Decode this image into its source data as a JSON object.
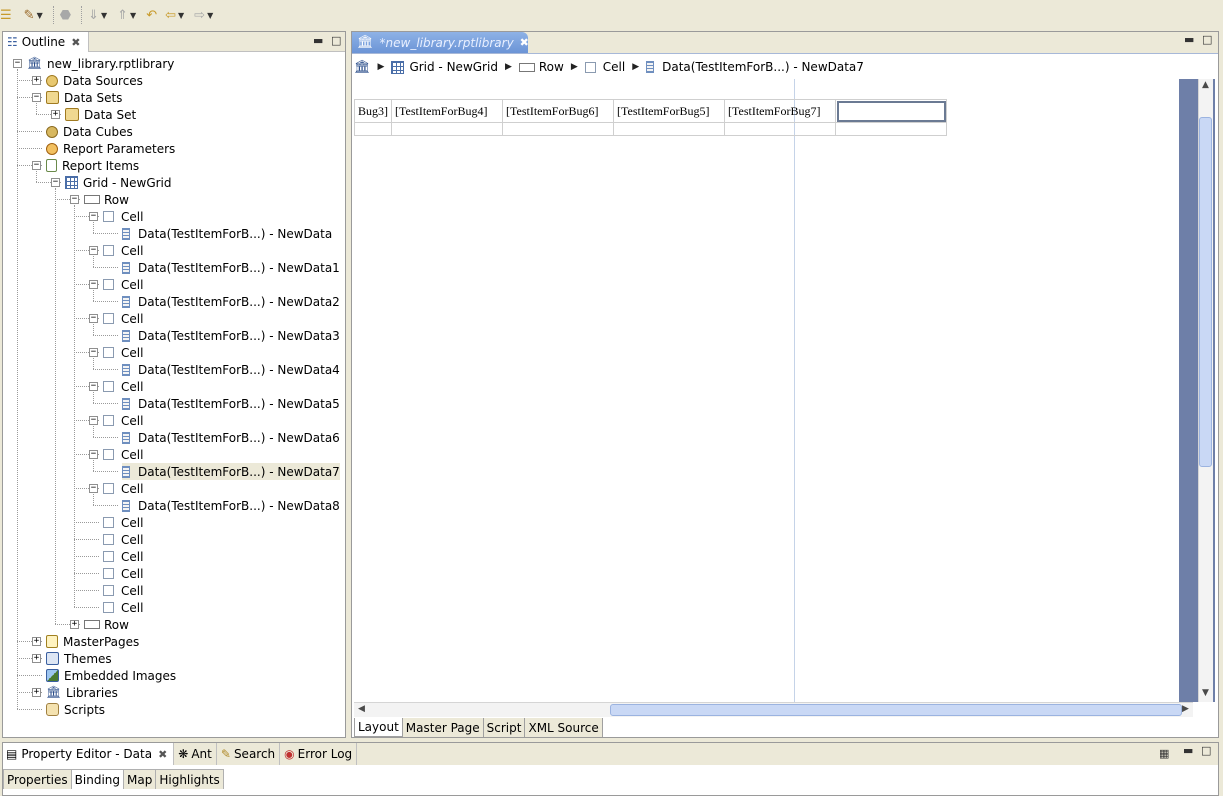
{
  "outline": {
    "title": "Outline",
    "tree": [
      {
        "label": "new_library.rptlibrary",
        "icon": "library-icon",
        "depth": 0,
        "expander": "minus"
      },
      {
        "label": "Data Sources",
        "icon": "data-sources-icon",
        "depth": 1,
        "expander": "plus"
      },
      {
        "label": "Data Sets",
        "icon": "data-sets-icon",
        "depth": 1,
        "expander": "minus"
      },
      {
        "label": "Data Set",
        "icon": "data-set-icon",
        "depth": 2,
        "expander": "plus"
      },
      {
        "label": "Data Cubes",
        "icon": "data-cubes-icon",
        "depth": 1,
        "expander": ""
      },
      {
        "label": "Report Parameters",
        "icon": "report-parameters-icon",
        "depth": 1,
        "expander": ""
      },
      {
        "label": "Report Items",
        "icon": "report-items-icon",
        "depth": 1,
        "expander": "minus"
      },
      {
        "label": "Grid - NewGrid",
        "icon": "grid-icon",
        "depth": 2,
        "expander": "minus"
      },
      {
        "label": "Row",
        "icon": "row-icon",
        "depth": 3,
        "expander": "minus"
      },
      {
        "label": "Cell",
        "icon": "cell-icon",
        "depth": 4,
        "expander": "minus"
      },
      {
        "label": "Data(TestItemForB...) - NewData",
        "icon": "data-item-icon",
        "depth": 5,
        "expander": ""
      },
      {
        "label": "Cell",
        "icon": "cell-icon",
        "depth": 4,
        "expander": "minus"
      },
      {
        "label": "Data(TestItemForB...) - NewData1",
        "icon": "data-item-icon",
        "depth": 5,
        "expander": ""
      },
      {
        "label": "Cell",
        "icon": "cell-icon",
        "depth": 4,
        "expander": "minus"
      },
      {
        "label": "Data(TestItemForB...) - NewData2",
        "icon": "data-item-icon",
        "depth": 5,
        "expander": ""
      },
      {
        "label": "Cell",
        "icon": "cell-icon",
        "depth": 4,
        "expander": "minus"
      },
      {
        "label": "Data(TestItemForB...) - NewData3",
        "icon": "data-item-icon",
        "depth": 5,
        "expander": ""
      },
      {
        "label": "Cell",
        "icon": "cell-icon",
        "depth": 4,
        "expander": "minus"
      },
      {
        "label": "Data(TestItemForB...) - NewData4",
        "icon": "data-item-icon",
        "depth": 5,
        "expander": ""
      },
      {
        "label": "Cell",
        "icon": "cell-icon",
        "depth": 4,
        "expander": "minus"
      },
      {
        "label": "Data(TestItemForB...) - NewData5",
        "icon": "data-item-icon",
        "depth": 5,
        "expander": ""
      },
      {
        "label": "Cell",
        "icon": "cell-icon",
        "depth": 4,
        "expander": "minus"
      },
      {
        "label": "Data(TestItemForB...) - NewData6",
        "icon": "data-item-icon",
        "depth": 5,
        "expander": ""
      },
      {
        "label": "Cell",
        "icon": "cell-icon",
        "depth": 4,
        "expander": "minus"
      },
      {
        "label": "Data(TestItemForB...) - NewData7",
        "icon": "data-item-icon",
        "depth": 5,
        "expander": "",
        "selected": true
      },
      {
        "label": "Cell",
        "icon": "cell-icon",
        "depth": 4,
        "expander": "minus"
      },
      {
        "label": "Data(TestItemForB...) - NewData8",
        "icon": "data-item-icon",
        "depth": 5,
        "expander": ""
      },
      {
        "label": "Cell",
        "icon": "cell-icon",
        "depth": 4,
        "expander": ""
      },
      {
        "label": "Cell",
        "icon": "cell-icon",
        "depth": 4,
        "expander": ""
      },
      {
        "label": "Cell",
        "icon": "cell-icon",
        "depth": 4,
        "expander": ""
      },
      {
        "label": "Cell",
        "icon": "cell-icon",
        "depth": 4,
        "expander": ""
      },
      {
        "label": "Cell",
        "icon": "cell-icon",
        "depth": 4,
        "expander": ""
      },
      {
        "label": "Cell",
        "icon": "cell-icon",
        "depth": 4,
        "expander": ""
      },
      {
        "label": "Row",
        "icon": "row-icon",
        "depth": 3,
        "expander": "plus"
      },
      {
        "label": "MasterPages",
        "icon": "master-pages-icon",
        "depth": 1,
        "expander": "plus"
      },
      {
        "label": "Themes",
        "icon": "themes-icon",
        "depth": 1,
        "expander": "plus"
      },
      {
        "label": "Embedded Images",
        "icon": "embedded-images-icon",
        "depth": 1,
        "expander": ""
      },
      {
        "label": "Libraries",
        "icon": "libraries-icon",
        "depth": 1,
        "expander": "plus"
      },
      {
        "label": "Scripts",
        "icon": "scripts-icon",
        "depth": 1,
        "expander": ""
      }
    ]
  },
  "editor": {
    "tab_title": "*new_library.rptlibrary",
    "breadcrumb": [
      "Grid - NewGrid",
      "Row",
      "Cell",
      "Data(TestItemForB...) - NewData7"
    ],
    "grid_cells": [
      "Bug3]",
      "[TestItemForBug4]",
      "[TestItemForBug6]",
      "[TestItemForBug5]",
      "[TestItemForBug7]",
      ""
    ],
    "bottom_tabs": [
      "Layout",
      "Master Page",
      "Script",
      "XML Source"
    ],
    "active_bottom_tab": "Layout"
  },
  "bottom_panel": {
    "active_view": "Property Editor - Data",
    "views": [
      "Ant",
      "Search",
      "Error Log"
    ],
    "subtabs": [
      "Properties",
      "Binding",
      "Map",
      "Highlights"
    ],
    "active_subtab": "Binding"
  },
  "colors": {
    "chrome": "#ece9d8",
    "editor_tab": "#7aa1de",
    "selection": "#ece9d8",
    "scrollbar_thumb": "#c9d8f5"
  }
}
